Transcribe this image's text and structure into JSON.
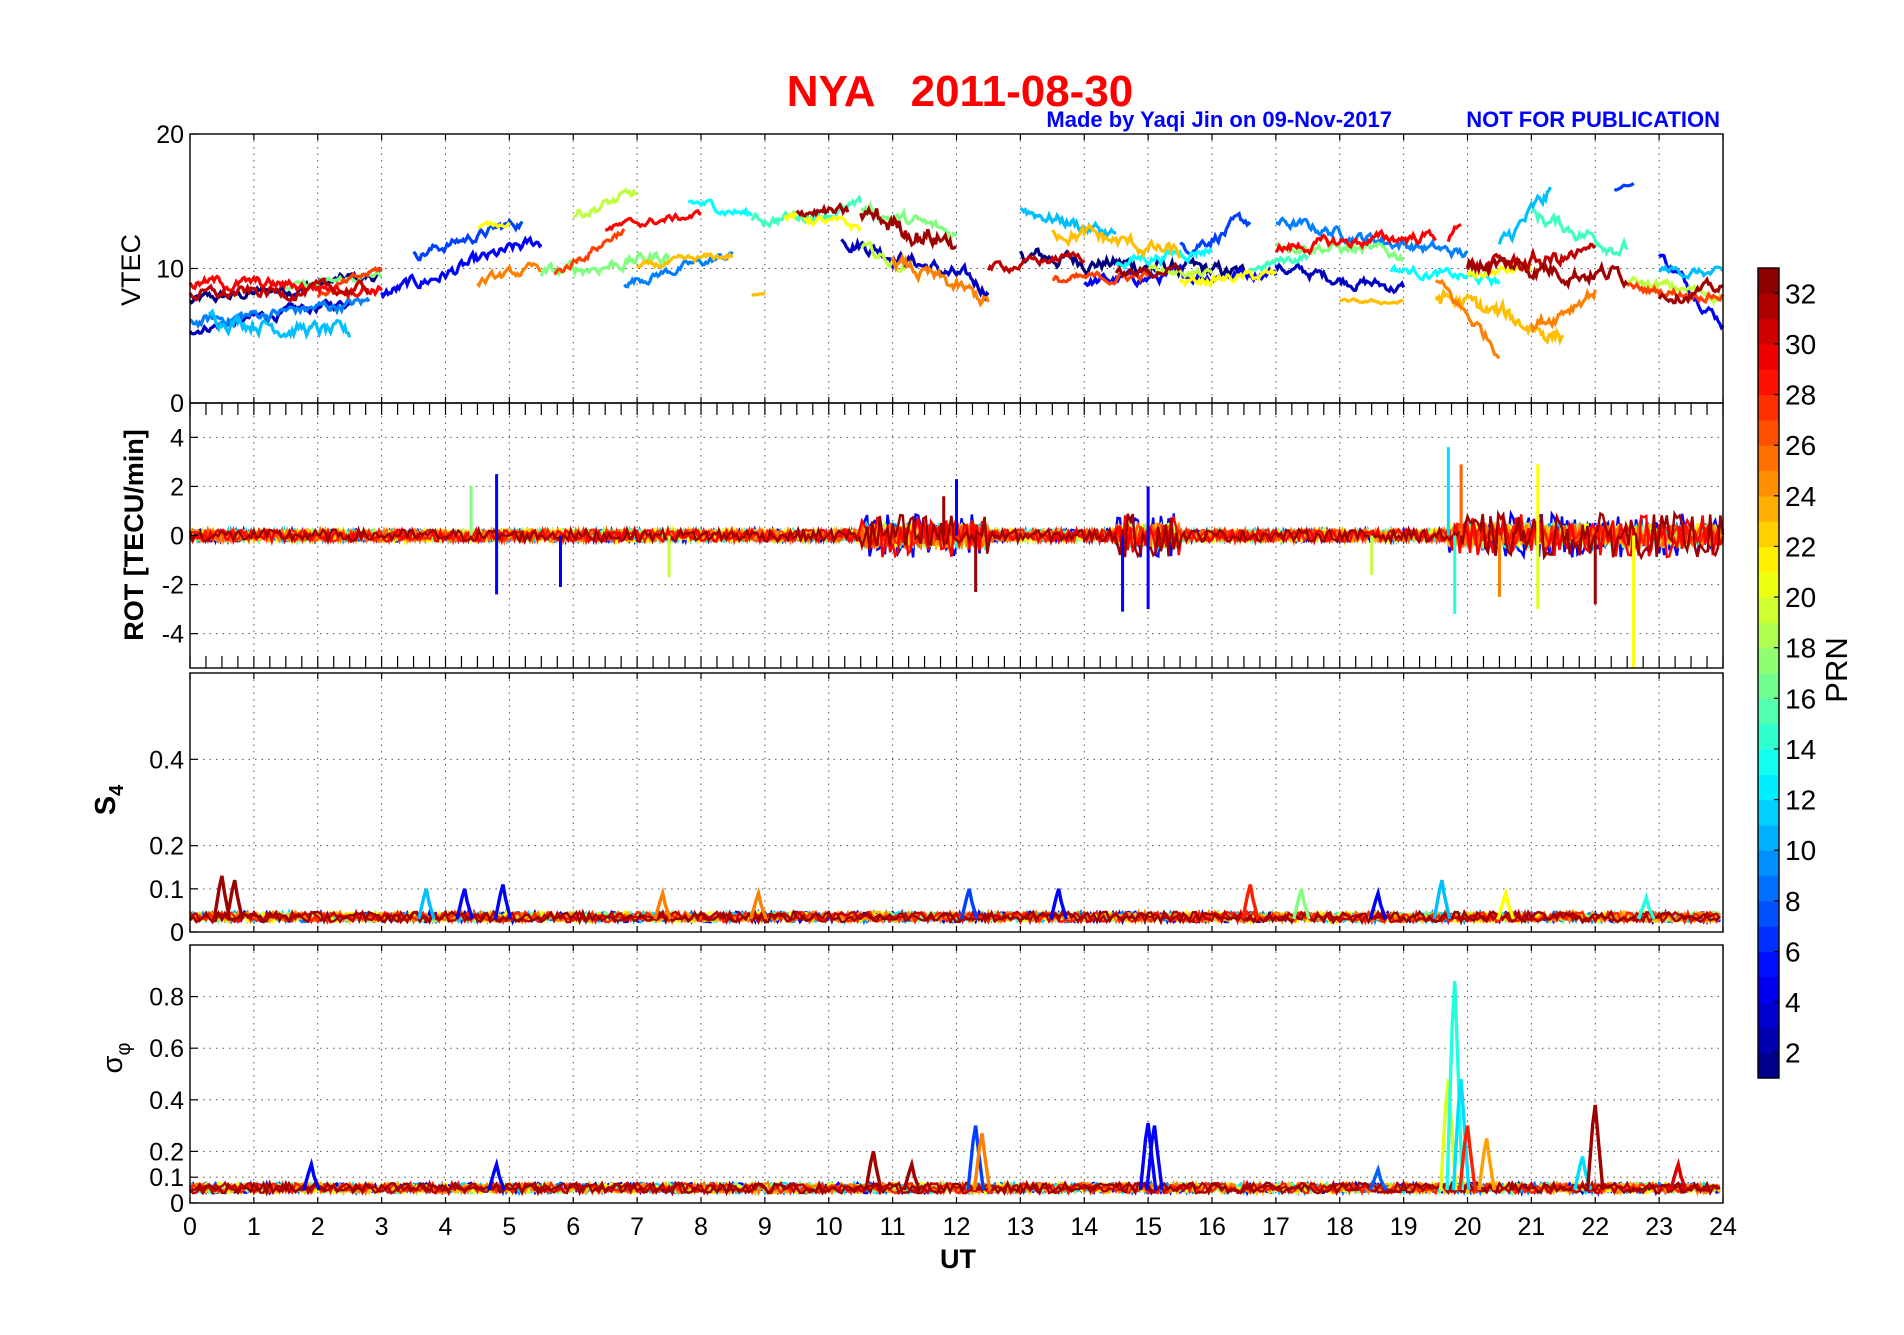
{
  "header": {
    "title": "NYA   2011-08-30",
    "credit": "Made by Yaqi Jin on 09-Nov-2017",
    "notice": "NOT FOR PUBLICATION",
    "title_color": "#ff0000",
    "credit_color": "#0000ff"
  },
  "colorbar": {
    "label": "PRN",
    "ticks": [
      "2",
      "4",
      "6",
      "8",
      "10",
      "12",
      "14",
      "16",
      "18",
      "20",
      "22",
      "24",
      "26",
      "28",
      "30",
      "32"
    ],
    "range": [
      1,
      33
    ],
    "colormap": "jet"
  },
  "chart_data": [
    {
      "type": "line",
      "panel": "vtec",
      "ylabel": "VTEC",
      "xlim": [
        0,
        24
      ],
      "ylim": [
        0,
        20
      ],
      "x_ticks": [
        "0",
        "1",
        "2",
        "3",
        "4",
        "5",
        "6",
        "7",
        "8",
        "9",
        "10",
        "11",
        "12",
        "13",
        "14",
        "15",
        "16",
        "17",
        "18",
        "19",
        "20",
        "21",
        "22",
        "23",
        "24"
      ],
      "y_ticks": [
        {
          "v": 0,
          "label": "0"
        },
        {
          "v": 10,
          "label": "10"
        },
        {
          "v": 20,
          "label": "20"
        }
      ],
      "grid": true,
      "series": [
        {
          "prn": 1,
          "segments": [
            {
              "t0": 0.0,
              "t1": 3.0,
              "y0": 7.5,
              "y1": 9.5,
              "noise": 0.6
            },
            {
              "t0": 13.0,
              "t1": 16.5,
              "y0": 11.0,
              "y1": 9.5,
              "noise": 0.8
            }
          ]
        },
        {
          "prn": 3,
          "segments": [
            {
              "t0": 0.0,
              "t1": 2.5,
              "y0": 5.5,
              "y1": 7.5,
              "noise": 0.5
            },
            {
              "t0": 10.2,
              "t1": 12.5,
              "y0": 12.5,
              "y1": 8.5,
              "noise": 0.8
            },
            {
              "t0": 17.0,
              "t1": 19.0,
              "y0": 10.0,
              "y1": 8.5,
              "noise": 0.6
            }
          ]
        },
        {
          "prn": 5,
          "segments": [
            {
              "t0": 3.0,
              "t1": 5.5,
              "y0": 8.0,
              "y1": 12.0,
              "noise": 0.7
            },
            {
              "t0": 14.0,
              "t1": 17.0,
              "y0": 9.0,
              "y1": 9.8,
              "noise": 0.6
            },
            {
              "t0": 23.0,
              "t1": 24.0,
              "y0": 11.0,
              "y1": 6.0,
              "noise": 0.6
            }
          ]
        },
        {
          "prn": 7,
          "segments": [
            {
              "t0": 3.5,
              "t1": 5.2,
              "y0": 11.0,
              "y1": 13.5,
              "noise": 0.6
            },
            {
              "t0": 15.5,
              "t1": 16.6,
              "y0": 11.5,
              "y1": 13.5,
              "noise": 0.7
            },
            {
              "t0": 22.3,
              "t1": 22.6,
              "y0": 15.8,
              "y1": 16.2,
              "noise": 0.2
            }
          ]
        },
        {
          "prn": 9,
          "segments": [
            {
              "t0": 0.0,
              "t1": 2.8,
              "y0": 6.0,
              "y1": 7.5,
              "noise": 0.6
            },
            {
              "t0": 6.8,
              "t1": 8.5,
              "y0": 9.0,
              "y1": 11.0,
              "noise": 0.5
            },
            {
              "t0": 17.0,
              "t1": 20.0,
              "y0": 13.5,
              "y1": 11.0,
              "noise": 0.6
            }
          ]
        },
        {
          "prn": 11,
          "segments": [
            {
              "t0": 0.3,
              "t1": 2.5,
              "y0": 6.5,
              "y1": 5.0,
              "noise": 0.8
            },
            {
              "t0": 13.0,
              "t1": 14.5,
              "y0": 14.5,
              "y1": 12.5,
              "noise": 0.7
            },
            {
              "t0": 20.5,
              "t1": 21.3,
              "y0": 11.5,
              "y1": 15.5,
              "noise": 0.9
            },
            {
              "t0": 23.0,
              "t1": 24.0,
              "y0": 10.0,
              "y1": 9.5,
              "noise": 0.5
            }
          ]
        },
        {
          "prn": 13,
          "segments": [
            {
              "t0": 7.8,
              "t1": 8.8,
              "y0": 15.0,
              "y1": 14.0,
              "noise": 0.5
            },
            {
              "t0": 14.5,
              "t1": 16.0,
              "y0": 10.5,
              "y1": 11.5,
              "noise": 0.6
            },
            {
              "t0": 18.8,
              "t1": 20.5,
              "y0": 10.0,
              "y1": 9.0,
              "noise": 0.5
            }
          ]
        },
        {
          "prn": 15,
          "segments": [
            {
              "t0": 8.8,
              "t1": 10.5,
              "y0": 13.5,
              "y1": 14.5,
              "noise": 0.6
            },
            {
              "t0": 16.6,
              "t1": 17.5,
              "y0": 10.0,
              "y1": 11.0,
              "noise": 0.5
            },
            {
              "t0": 21.0,
              "t1": 22.5,
              "y0": 14.0,
              "y1": 11.5,
              "noise": 0.8
            }
          ]
        },
        {
          "prn": 17,
          "segments": [
            {
              "t0": 1.5,
              "t1": 3.0,
              "y0": 8.5,
              "y1": 9.5,
              "noise": 0.4
            },
            {
              "t0": 5.5,
              "t1": 7.5,
              "y0": 9.5,
              "y1": 11.0,
              "noise": 0.7
            },
            {
              "t0": 10.5,
              "t1": 12.0,
              "y0": 14.5,
              "y1": 12.5,
              "noise": 0.7
            },
            {
              "t0": 17.0,
              "t1": 19.0,
              "y0": 12.0,
              "y1": 11.0,
              "noise": 0.6
            }
          ]
        },
        {
          "prn": 19,
          "segments": [
            {
              "t0": 6.0,
              "t1": 7.0,
              "y0": 14.0,
              "y1": 15.5,
              "noise": 0.6
            },
            {
              "t0": 10.5,
              "t1": 11.2,
              "y0": 11.5,
              "y1": 10.0,
              "noise": 0.6
            },
            {
              "t0": 15.0,
              "t1": 16.0,
              "y0": 10.0,
              "y1": 9.5,
              "noise": 0.4
            },
            {
              "t0": 22.5,
              "t1": 24.0,
              "y0": 9.0,
              "y1": 8.0,
              "noise": 0.6
            }
          ]
        },
        {
          "prn": 21,
          "segments": [
            {
              "t0": 4.5,
              "t1": 5.0,
              "y0": 13.0,
              "y1": 13.5,
              "noise": 0.3
            },
            {
              "t0": 9.3,
              "t1": 10.5,
              "y0": 14.0,
              "y1": 13.0,
              "noise": 0.5
            },
            {
              "t0": 15.5,
              "t1": 17.0,
              "y0": 9.0,
              "y1": 9.5,
              "noise": 0.5
            },
            {
              "t0": 20.0,
              "t1": 21.0,
              "y0": 9.5,
              "y1": 10.0,
              "noise": 0.5
            }
          ]
        },
        {
          "prn": 23,
          "segments": [
            {
              "t0": 7.0,
              "t1": 8.5,
              "y0": 10.0,
              "y1": 11.0,
              "noise": 0.4
            },
            {
              "t0": 8.8,
              "t1": 9.0,
              "y0": 8.0,
              "y1": 8.0,
              "noise": 0.2
            },
            {
              "t0": 13.5,
              "t1": 15.5,
              "y0": 13.0,
              "y1": 11.0,
              "noise": 0.8
            },
            {
              "t0": 18.0,
              "t1": 19.0,
              "y0": 7.5,
              "y1": 7.5,
              "noise": 0.2
            },
            {
              "t0": 19.5,
              "t1": 21.5,
              "y0": 8.0,
              "y1": 5.0,
              "noise": 1.0
            }
          ]
        },
        {
          "prn": 25,
          "segments": [
            {
              "t0": 4.5,
              "t1": 5.5,
              "y0": 9.0,
              "y1": 10.0,
              "noise": 0.5
            },
            {
              "t0": 11.0,
              "t1": 12.5,
              "y0": 10.5,
              "y1": 7.5,
              "noise": 0.8
            },
            {
              "t0": 19.5,
              "t1": 20.5,
              "y0": 9.0,
              "y1": 4.0,
              "noise": 0.7
            },
            {
              "t0": 21.0,
              "t1": 22.0,
              "y0": 5.5,
              "y1": 8.5,
              "noise": 0.8
            }
          ]
        },
        {
          "prn": 27,
          "segments": [
            {
              "t0": 2.0,
              "t1": 3.0,
              "y0": 8.0,
              "y1": 10.0,
              "noise": 0.4
            },
            {
              "t0": 5.7,
              "t1": 6.8,
              "y0": 9.5,
              "y1": 13.0,
              "noise": 0.5
            },
            {
              "t0": 13.5,
              "t1": 15.0,
              "y0": 9.0,
              "y1": 9.5,
              "noise": 0.5
            },
            {
              "t0": 22.5,
              "t1": 24.0,
              "y0": 8.5,
              "y1": 8.0,
              "noise": 0.5
            }
          ]
        },
        {
          "prn": 29,
          "segments": [
            {
              "t0": 0.0,
              "t1": 3.0,
              "y0": 9.0,
              "y1": 8.5,
              "noise": 0.6
            },
            {
              "t0": 6.5,
              "t1": 8.0,
              "y0": 13.0,
              "y1": 14.0,
              "noise": 0.4
            },
            {
              "t0": 17.0,
              "t1": 19.5,
              "y0": 11.5,
              "y1": 12.5,
              "noise": 0.6
            },
            {
              "t0": 19.7,
              "t1": 19.9,
              "y0": 12.0,
              "y1": 13.5,
              "noise": 0.5
            }
          ]
        },
        {
          "prn": 31,
          "segments": [
            {
              "t0": 0.0,
              "t1": 2.8,
              "y0": 8.0,
              "y1": 8.5,
              "noise": 0.6
            },
            {
              "t0": 12.5,
              "t1": 14.0,
              "y0": 10.0,
              "y1": 11.0,
              "noise": 0.5
            },
            {
              "t0": 20.0,
              "t1": 22.0,
              "y0": 10.0,
              "y1": 11.0,
              "noise": 0.9
            }
          ]
        },
        {
          "prn": 32,
          "segments": [
            {
              "t0": 9.5,
              "t1": 10.3,
              "y0": 14.5,
              "y1": 14.0,
              "noise": 0.6
            },
            {
              "t0": 10.5,
              "t1": 12.0,
              "y0": 14.0,
              "y1": 12.0,
              "noise": 1.2
            },
            {
              "t0": 14.5,
              "t1": 15.5,
              "y0": 9.5,
              "y1": 10.0,
              "noise": 0.5
            },
            {
              "t0": 20.0,
              "t1": 22.5,
              "y0": 10.5,
              "y1": 9.5,
              "noise": 0.9
            },
            {
              "t0": 23.0,
              "t1": 24.0,
              "y0": 8.0,
              "y1": 8.5,
              "noise": 0.6
            }
          ]
        }
      ]
    },
    {
      "type": "line",
      "panel": "rot",
      "ylabel": "ROT [TECU/min]",
      "xlim": [
        0,
        24
      ],
      "ylim": [
        -5.4,
        5.4
      ],
      "y_ticks": [
        {
          "v": -4,
          "label": "-4"
        },
        {
          "v": -2,
          "label": "-2"
        },
        {
          "v": 0,
          "label": "0"
        },
        {
          "v": 2,
          "label": "2"
        },
        {
          "v": 4,
          "label": "4"
        }
      ],
      "grid": true,
      "active_windows": [
        [
          10.5,
          12.5
        ],
        [
          14.5,
          15.5
        ],
        [
          19.7,
          24.0
        ]
      ],
      "spikes": [
        {
          "t": 4.8,
          "v": 2.5,
          "prn": 5
        },
        {
          "t": 4.8,
          "v": -2.4,
          "prn": 5
        },
        {
          "t": 5.8,
          "v": -2.1,
          "prn": 5
        },
        {
          "t": 4.4,
          "v": 2.0,
          "prn": 17
        },
        {
          "t": 12.0,
          "v": 2.3,
          "prn": 5
        },
        {
          "t": 12.3,
          "v": -2.3,
          "prn": 32
        },
        {
          "t": 11.8,
          "v": 1.6,
          "prn": 32
        },
        {
          "t": 14.6,
          "v": -3.1,
          "prn": 5
        },
        {
          "t": 15.0,
          "v": -3.0,
          "prn": 5
        },
        {
          "t": 15.0,
          "v": 2.0,
          "prn": 5
        },
        {
          "t": 19.7,
          "v": 3.6,
          "prn": 12
        },
        {
          "t": 19.8,
          "v": -3.2,
          "prn": 14
        },
        {
          "t": 19.9,
          "v": 2.9,
          "prn": 26
        },
        {
          "t": 20.5,
          "v": -2.5,
          "prn": 25
        },
        {
          "t": 21.1,
          "v": 2.9,
          "prn": 21
        },
        {
          "t": 21.1,
          "v": -3.0,
          "prn": 20
        },
        {
          "t": 22.0,
          "v": -2.8,
          "prn": 32
        },
        {
          "t": 22.6,
          "v": -5.4,
          "prn": 21
        },
        {
          "t": 7.5,
          "v": -1.7,
          "prn": 19
        },
        {
          "t": 18.5,
          "v": -1.6,
          "prn": 19
        }
      ]
    },
    {
      "type": "line",
      "panel": "s4",
      "ylabel": "S4",
      "xlim": [
        0,
        24
      ],
      "ylim": [
        0,
        0.6
      ],
      "y_ticks": [
        {
          "v": 0,
          "label": "0"
        },
        {
          "v": 0.1,
          "label": "0.1"
        },
        {
          "v": 0.2,
          "label": "0.2"
        },
        {
          "v": 0.4,
          "label": "0.4"
        }
      ],
      "grid": true,
      "baseline": 0.03,
      "spikes": [
        {
          "t": 0.5,
          "v": 0.13,
          "prn": 32
        },
        {
          "t": 0.7,
          "v": 0.12,
          "prn": 32
        },
        {
          "t": 3.7,
          "v": 0.1,
          "prn": 11
        },
        {
          "t": 4.3,
          "v": 0.1,
          "prn": 5
        },
        {
          "t": 4.9,
          "v": 0.11,
          "prn": 5
        },
        {
          "t": 7.4,
          "v": 0.09,
          "prn": 25
        },
        {
          "t": 8.9,
          "v": 0.09,
          "prn": 25
        },
        {
          "t": 12.2,
          "v": 0.1,
          "prn": 7
        },
        {
          "t": 13.6,
          "v": 0.1,
          "prn": 5
        },
        {
          "t": 16.6,
          "v": 0.11,
          "prn": 28
        },
        {
          "t": 17.4,
          "v": 0.1,
          "prn": 17
        },
        {
          "t": 18.6,
          "v": 0.09,
          "prn": 5
        },
        {
          "t": 19.6,
          "v": 0.12,
          "prn": 11
        },
        {
          "t": 20.6,
          "v": 0.09,
          "prn": 21
        },
        {
          "t": 22.8,
          "v": 0.08,
          "prn": 14
        }
      ]
    },
    {
      "type": "line",
      "panel": "sigma",
      "ylabel": "σφ",
      "xlim": [
        0,
        24
      ],
      "ylim": [
        0,
        1.0
      ],
      "y_ticks": [
        {
          "v": 0,
          "label": "0"
        },
        {
          "v": 0.1,
          "label": "0.1"
        },
        {
          "v": 0.2,
          "label": "0.2"
        },
        {
          "v": 0.4,
          "label": "0.4"
        },
        {
          "v": 0.6,
          "label": "0.6"
        },
        {
          "v": 0.8,
          "label": "0.8"
        }
      ],
      "grid": true,
      "baseline": 0.05,
      "spikes": [
        {
          "t": 1.9,
          "v": 0.15,
          "prn": 5
        },
        {
          "t": 4.8,
          "v": 0.15,
          "prn": 5
        },
        {
          "t": 10.7,
          "v": 0.2,
          "prn": 32
        },
        {
          "t": 11.3,
          "v": 0.15,
          "prn": 32
        },
        {
          "t": 12.3,
          "v": 0.3,
          "prn": 7
        },
        {
          "t": 12.4,
          "v": 0.27,
          "prn": 25
        },
        {
          "t": 15.0,
          "v": 0.31,
          "prn": 5
        },
        {
          "t": 15.1,
          "v": 0.3,
          "prn": 5
        },
        {
          "t": 19.7,
          "v": 0.48,
          "prn": 20
        },
        {
          "t": 19.8,
          "v": 0.86,
          "prn": 14
        },
        {
          "t": 19.9,
          "v": 0.48,
          "prn": 12
        },
        {
          "t": 20.0,
          "v": 0.3,
          "prn": 28
        },
        {
          "t": 20.3,
          "v": 0.25,
          "prn": 24
        },
        {
          "t": 21.8,
          "v": 0.18,
          "prn": 12
        },
        {
          "t": 22.0,
          "v": 0.38,
          "prn": 32
        },
        {
          "t": 23.3,
          "v": 0.15,
          "prn": 30
        },
        {
          "t": 18.6,
          "v": 0.13,
          "prn": 8
        }
      ]
    }
  ]
}
